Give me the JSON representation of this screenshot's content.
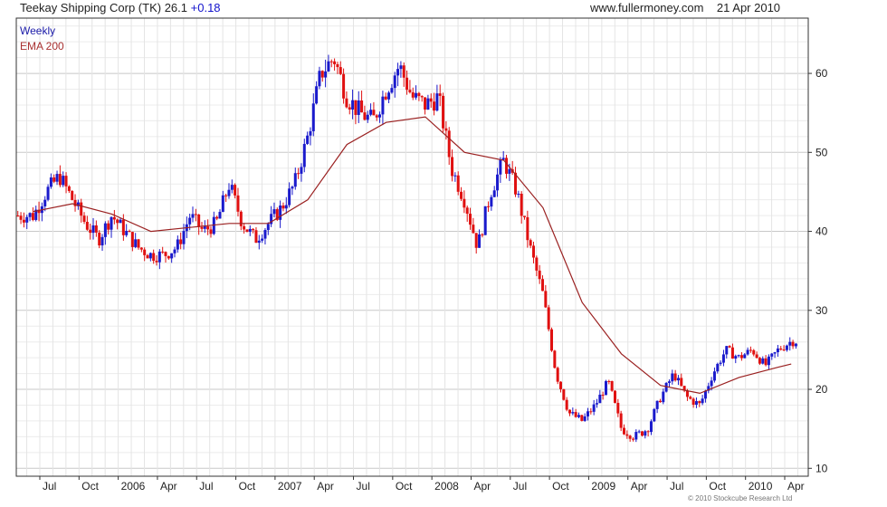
{
  "header": {
    "title": "Teekay Shipping Corp (TK)",
    "price": "26.1",
    "change": "+0.18",
    "source": "www.fullermoney.com",
    "date": "21 Apr 2010"
  },
  "footer": {
    "credit": "© 2010 Stockcube Research Ltd"
  },
  "colors": {
    "up": "#1a1acc",
    "down": "#e01010",
    "ema": "#9a2020",
    "grid": "#d4d4d4",
    "frame": "#333333"
  },
  "chart_data": {
    "type": "line",
    "grid": true,
    "legend_position": "top-left",
    "legend": [
      "Weekly",
      "EMA 200"
    ],
    "ylim": [
      9,
      67
    ],
    "y_ticks": [
      10,
      20,
      30,
      40,
      50,
      60
    ],
    "y_axis_side": "right",
    "x_ticks": [
      "Jul",
      "Oct",
      "2006",
      "Apr",
      "Jul",
      "Oct",
      "2007",
      "Apr",
      "Jul",
      "Oct",
      "2008",
      "Apr",
      "Jul",
      "Oct",
      "2009",
      "Apr",
      "Jul",
      "Oct",
      "2010",
      "Apr"
    ],
    "series": [
      {
        "name": "Weekly",
        "kind": "price-bars",
        "x": [
          "2005-06",
          "2005-07",
          "2005-08",
          "2005-09",
          "2005-10",
          "2005-11",
          "2005-12",
          "2006-01",
          "2006-02",
          "2006-03",
          "2006-04",
          "2006-05",
          "2006-06",
          "2006-07",
          "2006-08",
          "2006-09",
          "2006-10",
          "2006-11",
          "2006-12",
          "2007-01",
          "2007-02",
          "2007-03",
          "2007-04",
          "2007-05",
          "2007-06",
          "2007-07",
          "2007-08",
          "2007-09",
          "2007-10",
          "2007-11",
          "2007-12",
          "2008-01",
          "2008-02",
          "2008-03",
          "2008-04",
          "2008-05",
          "2008-06",
          "2008-07",
          "2008-08",
          "2008-09",
          "2008-10",
          "2008-11",
          "2008-12",
          "2009-01",
          "2009-02",
          "2009-03",
          "2009-04",
          "2009-05",
          "2009-06",
          "2009-07",
          "2009-08",
          "2009-09",
          "2009-10",
          "2009-11",
          "2009-12",
          "2010-01",
          "2010-02",
          "2010-03",
          "2010-04"
        ],
        "values": [
          42,
          45,
          47,
          44,
          41,
          39,
          42,
          40,
          38,
          37,
          37,
          38,
          42,
          40,
          41,
          46,
          41,
          39,
          41,
          43,
          46,
          52,
          60,
          62,
          57,
          55,
          54,
          58,
          61,
          57,
          56,
          57,
          48,
          44,
          38,
          45,
          49,
          45,
          38,
          32,
          22,
          17,
          16,
          18,
          21,
          15,
          14,
          15,
          19,
          22,
          19,
          18,
          22,
          25,
          24,
          25,
          23,
          25,
          26.1
        ]
      },
      {
        "name": "EMA 200",
        "kind": "line",
        "x": [
          "2005-06",
          "2005-09",
          "2005-12",
          "2006-03",
          "2006-06",
          "2006-09",
          "2006-12",
          "2007-03",
          "2007-06",
          "2007-09",
          "2007-12",
          "2008-03",
          "2008-06",
          "2008-09",
          "2008-12",
          "2009-03",
          "2009-06",
          "2009-09",
          "2009-12",
          "2010-03",
          "2010-04"
        ],
        "values": [
          42.5,
          43.5,
          42.2,
          40,
          40.5,
          41,
          41,
          44,
          51,
          53.8,
          54.5,
          50,
          49,
          43,
          31,
          24.5,
          20.5,
          19.5,
          21.5,
          22.8,
          23.2
        ]
      }
    ]
  }
}
